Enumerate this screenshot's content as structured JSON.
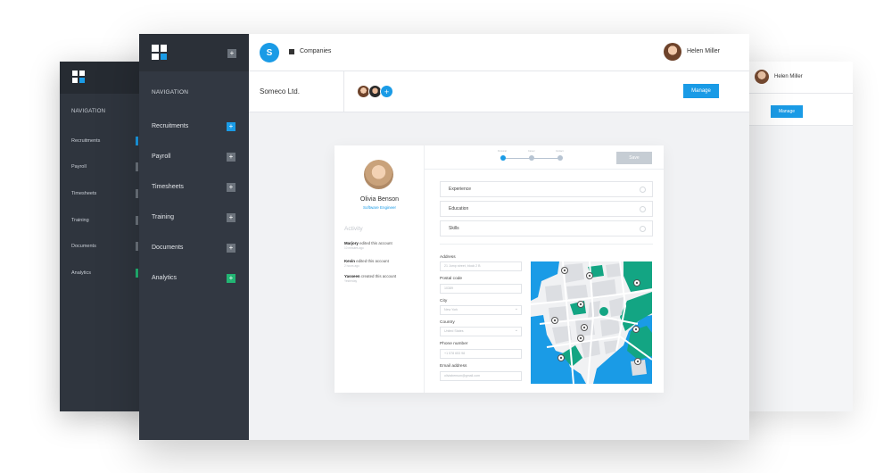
{
  "back_left": {
    "nav_title": "NAVIGATION",
    "items": [
      "Recruitments",
      "Payroll",
      "Timesheets",
      "Training",
      "Documents",
      "Analytics"
    ]
  },
  "back_right": {
    "user_name": "Helen Miller",
    "manage_label": "Manage"
  },
  "sidebar": {
    "collapse_label": "+",
    "nav_title": "NAVIGATION",
    "items": [
      {
        "label": "Recruitments",
        "plus": "+",
        "color": "#1a9be6"
      },
      {
        "label": "Payroll",
        "plus": "+",
        "color": "#6c737c"
      },
      {
        "label": "Timesheets",
        "plus": "+",
        "color": "#6c737c"
      },
      {
        "label": "Training",
        "plus": "+",
        "color": "#6c737c"
      },
      {
        "label": "Documents",
        "plus": "+",
        "color": "#6c737c"
      },
      {
        "label": "Analytics",
        "plus": "+",
        "color": "#22b573"
      }
    ]
  },
  "topbar": {
    "badge": "S",
    "section": "Companies",
    "user_name": "Helen Miller"
  },
  "subbar": {
    "company": "Someco Ltd.",
    "add_label": "+",
    "manage_label": "Manage"
  },
  "profile": {
    "name": "Olivia Benson",
    "role": "Software Engineer",
    "activity_title": "Activity",
    "activity": [
      {
        "who": "Marjory",
        "action": "edited this account",
        "time": "10 minutes ago"
      },
      {
        "who": "Kevin",
        "action": "edited this account",
        "time": "2 hours ago"
      },
      {
        "who": "Yasseen",
        "action": "created this account",
        "time": "Yesterday"
      }
    ]
  },
  "steps": {
    "labels": [
      "Personal",
      "Career",
      "Contact"
    ],
    "current": 1
  },
  "save_label": "Save",
  "sections": [
    "Experience",
    "Education",
    "Skills"
  ],
  "form": {
    "address_label": "Address",
    "address_value": "21 Jump street, block 2 B",
    "postal_label": "Postal code",
    "postal_value": "10389",
    "city_label": "City",
    "city_value": "New York",
    "country_label": "Country",
    "country_value": "United States",
    "phone_label": "Phone number",
    "phone_value": "+1 578 653 98",
    "email_label": "Email address",
    "email_value": "oliviabenson@gmail.com"
  },
  "colors": {
    "accent": "#1a9be6",
    "park": "#13a583",
    "water": "#1a9be6"
  }
}
